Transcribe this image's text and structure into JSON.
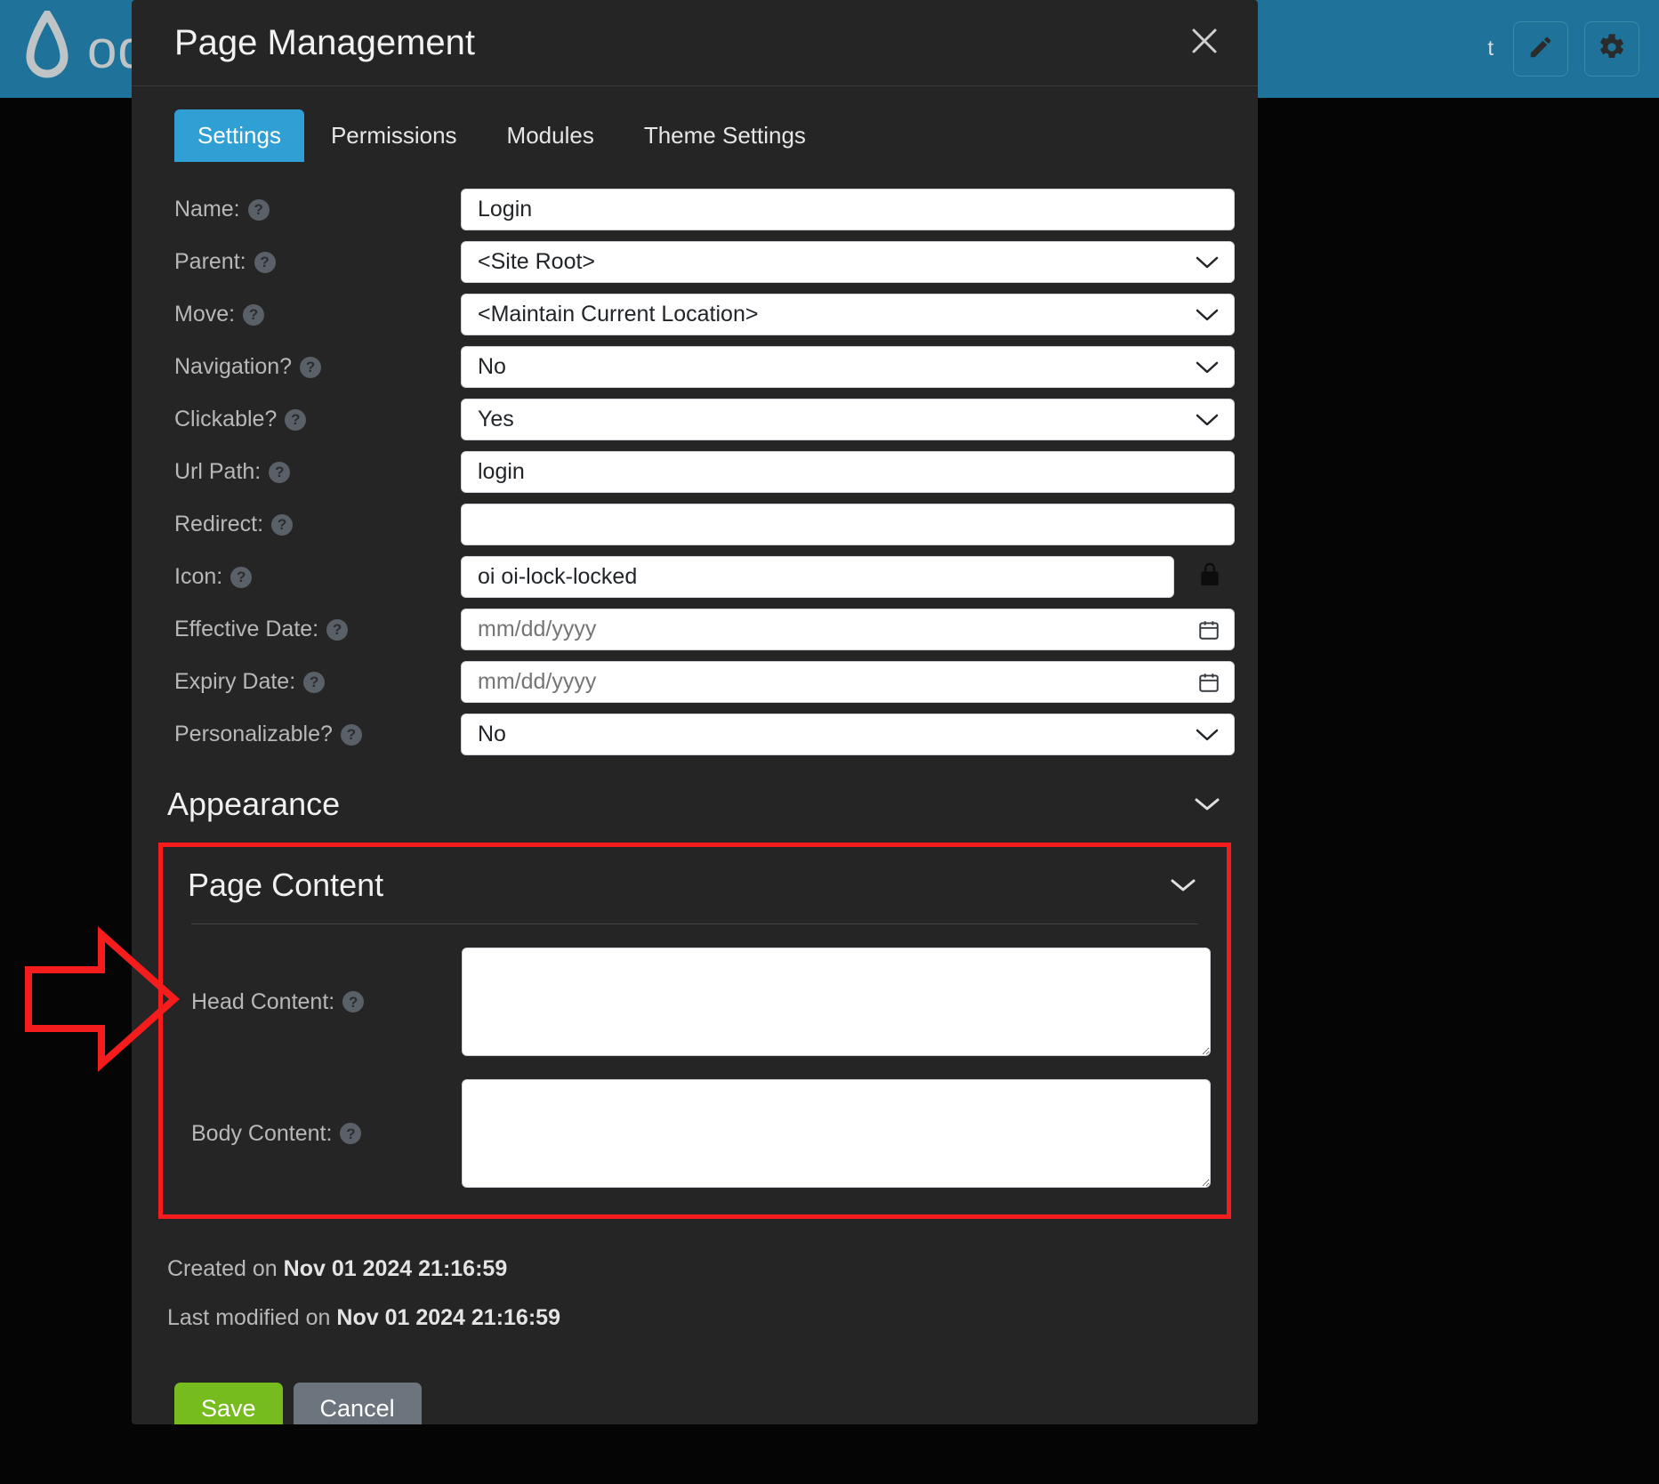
{
  "app": {
    "brand_name": "oqtane",
    "logo_icon": "water-drop-icon",
    "header_user_text": "t",
    "edit_icon": "pencil-icon",
    "settings_icon": "gear-icon",
    "accent_color": "#1f7299"
  },
  "modal": {
    "title": "Page Management",
    "close_icon": "close-icon",
    "tabs": [
      {
        "label": "Settings",
        "active": true
      },
      {
        "label": "Permissions",
        "active": false
      },
      {
        "label": "Modules",
        "active": false
      },
      {
        "label": "Theme Settings",
        "active": false
      }
    ],
    "fields": [
      {
        "label": "Name:",
        "type": "text",
        "value": "Login",
        "placeholder": ""
      },
      {
        "label": "Parent:",
        "type": "select",
        "value": "<Site Root>"
      },
      {
        "label": "Move:",
        "type": "select",
        "value": "<Maintain Current Location>"
      },
      {
        "label": "Navigation?",
        "type": "select",
        "value": "No"
      },
      {
        "label": "Clickable?",
        "type": "select",
        "value": "Yes"
      },
      {
        "label": "Url Path:",
        "type": "text",
        "value": "login",
        "placeholder": ""
      },
      {
        "label": "Redirect:",
        "type": "text",
        "value": "",
        "placeholder": ""
      },
      {
        "label": "Icon:",
        "type": "text-with-button",
        "value": "oi oi-lock-locked",
        "button_icon": "lock-icon"
      },
      {
        "label": "Effective Date:",
        "type": "date",
        "value": "",
        "placeholder": "mm/dd/yyyy",
        "date_icon": "calendar-icon"
      },
      {
        "label": "Expiry Date:",
        "type": "date",
        "value": "",
        "placeholder": "mm/dd/yyyy",
        "date_icon": "calendar-icon"
      },
      {
        "label": "Personalizable?",
        "type": "select",
        "value": "No"
      }
    ],
    "help_icon_glyph": "?",
    "sections": {
      "appearance": {
        "title": "Appearance",
        "caret_icon": "chevron-down-icon",
        "expanded": false
      },
      "page_content": {
        "title": "Page Content",
        "caret_icon": "chevron-down-icon",
        "expanded": true,
        "highlighted": true,
        "highlight_color": "#f41c1c",
        "fields": [
          {
            "label": "Head Content:",
            "value": "",
            "placeholder": ""
          },
          {
            "label": "Body Content:",
            "value": "",
            "placeholder": ""
          }
        ]
      }
    },
    "meta": {
      "created_prefix": "Created on",
      "created_date": "Nov 01 2024 21:16:59",
      "modified_prefix": "Last modified on",
      "modified_date": "Nov 01 2024 21:16:59"
    },
    "footer": {
      "save_label": "Save",
      "cancel_label": "Cancel",
      "save_color": "#77bc1f",
      "cancel_color": "#6c757d"
    }
  },
  "annotation": {
    "arrow_icon": "right-arrow-annotation",
    "color": "#f41c1c"
  }
}
